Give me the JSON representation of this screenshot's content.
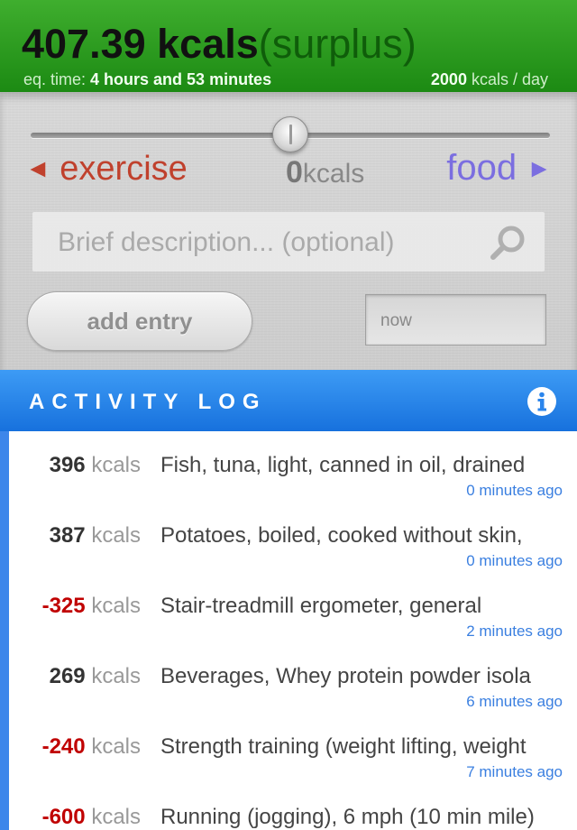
{
  "summary": {
    "kcal_value": "407.39 kcals",
    "kcal_status": "(surplus)",
    "eq_time_label": "eq. time: ",
    "eq_time_value": "4 hours and 53 minutes",
    "daily_value": "2000",
    "daily_unit": " kcals / day"
  },
  "input": {
    "exercise_label": "exercise",
    "exercise_arrow": "◄",
    "food_label": "food",
    "food_arrow": "►",
    "slider_value": "0",
    "slider_unit": "kcals",
    "slider_level": 0.5,
    "description_placeholder": "Brief description... (optional)",
    "add_button_label": "add entry",
    "time_placeholder": "now"
  },
  "log": {
    "title": "ACTIVITY LOG",
    "unit": "kcals",
    "entries": [
      {
        "value": "396",
        "name": "Fish, tuna, light, canned in oil, drained",
        "ago": "0 minutes ago",
        "negative": false
      },
      {
        "value": "387",
        "name": "Potatoes, boiled, cooked without skin,",
        "ago": "0 minutes ago",
        "negative": false
      },
      {
        "value": "-325",
        "name": "Stair-treadmill ergometer, general",
        "ago": "2 minutes ago",
        "negative": true
      },
      {
        "value": "269",
        "name": "Beverages, Whey protein powder isola",
        "ago": "6 minutes ago",
        "negative": false
      },
      {
        "value": "-240",
        "name": "Strength training (weight lifting, weight",
        "ago": "7 minutes ago",
        "negative": true
      },
      {
        "value": "-600",
        "name": "Running (jogging), 6 mph (10 min mile)",
        "ago": "",
        "negative": true
      }
    ]
  },
  "colors": {
    "header_green": "#2a9c20",
    "exercise": "#c0412d",
    "food": "#7b6ee0",
    "log_blue": "#2b85ec",
    "negative": "#c00000",
    "timestamp": "#3a7fe0"
  },
  "icons": {
    "search": "search-icon",
    "info": "info-icon",
    "slider_thumb": "slider-thumb"
  }
}
